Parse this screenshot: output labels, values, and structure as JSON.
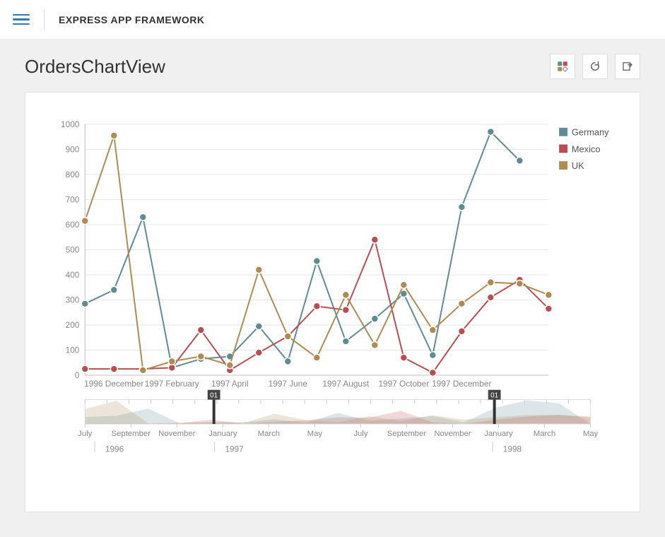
{
  "header": {
    "brand": "EXPRESS APP FRAMEWORK"
  },
  "page": {
    "title": "OrdersChartView"
  },
  "toolbar": {
    "designer_title": "Designer",
    "refresh_title": "Refresh",
    "export_title": "Export"
  },
  "chart_data": {
    "type": "line",
    "ylabel": "",
    "xlabel": "",
    "ylim": [
      0,
      1000
    ],
    "x_ticks": [
      "1996 December",
      "1997 February",
      "1997 April",
      "1997 June",
      "1997 August",
      "1997 October",
      "1997 December"
    ],
    "colors": {
      "Germany": "#5f8b95",
      "Mexico": "#ba4d51",
      "UK": "#af8a53"
    },
    "x": [
      "1996-11",
      "1996-12",
      "1997-01",
      "1997-02",
      "1997-03",
      "1997-04",
      "1997-05",
      "1997-06",
      "1997-07",
      "1997-08",
      "1997-09",
      "1997-10",
      "1997-11",
      "1997-12",
      "1998-01",
      "1998-02",
      "1998-03"
    ],
    "series": [
      {
        "name": "Germany",
        "values": [
          285,
          340,
          630,
          30,
          65,
          75,
          195,
          55,
          455,
          135,
          225,
          325,
          80,
          670,
          970,
          855,
          null
        ]
      },
      {
        "name": "Mexico",
        "values": [
          25,
          25,
          25,
          30,
          180,
          20,
          90,
          155,
          275,
          260,
          540,
          70,
          10,
          175,
          310,
          380,
          265
        ]
      },
      {
        "name": "UK",
        "values": [
          615,
          955,
          20,
          55,
          75,
          40,
          420,
          155,
          70,
          320,
          120,
          360,
          180,
          285,
          370,
          365,
          320
        ]
      }
    ],
    "legend": [
      "Germany",
      "Mexico",
      "UK"
    ],
    "range_selector": {
      "ticks": [
        "July",
        "September",
        "November",
        "January",
        "March",
        "May",
        "July",
        "September",
        "November",
        "January",
        "March",
        "May"
      ],
      "years": [
        {
          "label": "1996",
          "pos": 0.04
        },
        {
          "label": "1997",
          "pos": 0.277
        },
        {
          "label": "1998",
          "pos": 0.827
        }
      ],
      "window": {
        "start_label": "01",
        "end_label": "01",
        "start_frac": 0.255,
        "end_frac": 0.81
      }
    }
  }
}
